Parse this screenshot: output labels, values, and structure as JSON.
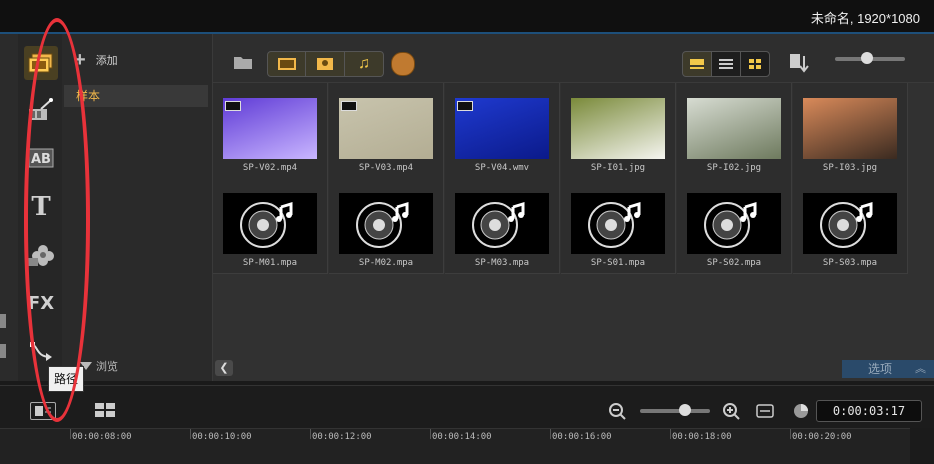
{
  "window": {
    "project_title": "未命名, 1920*1080"
  },
  "sidebar_icons": [
    {
      "name": "media",
      "icon": "media-icon"
    },
    {
      "name": "instant-project",
      "icon": "magic-wand-icon"
    },
    {
      "name": "transition",
      "icon": "transition-ab-icon"
    },
    {
      "name": "title",
      "icon": "title-t-icon"
    },
    {
      "name": "graphic",
      "icon": "graphic-flower-icon"
    },
    {
      "name": "filter",
      "icon": "fx-icon",
      "label": "FX"
    },
    {
      "name": "path",
      "icon": "path-icon"
    }
  ],
  "library": {
    "add_label": "添加",
    "selected_folder": "样本",
    "browse_label": "浏览"
  },
  "toolbar": {
    "filter_buttons": [
      "show-video",
      "show-photo",
      "show-audio"
    ],
    "view_modes": [
      "thumbnail-view",
      "list-view",
      "details-view"
    ]
  },
  "media_items": [
    {
      "name": "SP-V02.mp4",
      "type": "video",
      "colors": [
        "#5f3bd6",
        "#c9b6ff"
      ]
    },
    {
      "name": "SP-V03.mp4",
      "type": "video",
      "colors": [
        "#c8c4ad",
        "#b3ad93"
      ]
    },
    {
      "name": "SP-V04.wmv",
      "type": "video",
      "colors": [
        "#1f3ad0",
        "#0b1a8a"
      ]
    },
    {
      "name": "SP-I01.jpg",
      "type": "image",
      "colors": [
        "#7a8a3a",
        "#f5f5f0"
      ]
    },
    {
      "name": "SP-I02.jpg",
      "type": "image",
      "colors": [
        "#d7dcd2",
        "#6e7a5e"
      ]
    },
    {
      "name": "SP-I03.jpg",
      "type": "image",
      "colors": [
        "#d98a5a",
        "#3a2a20"
      ]
    },
    {
      "name": "SP-M01.mpa",
      "type": "audio"
    },
    {
      "name": "SP-M02.mpa",
      "type": "audio"
    },
    {
      "name": "SP-M03.mpa",
      "type": "audio"
    },
    {
      "name": "SP-S01.mpa",
      "type": "audio"
    },
    {
      "name": "SP-S02.mpa",
      "type": "audio"
    },
    {
      "name": "SP-S03.mpa",
      "type": "audio"
    }
  ],
  "options_label": "选项",
  "tooltip": "路径",
  "timeline": {
    "timecode": "0:00:03:17",
    "ruler_labels": [
      "00:00:08:00",
      "00:00:10:00",
      "00:00:12:00",
      "00:00:14:00",
      "00:00:16:00",
      "00:00:18:00",
      "00:00:20:00"
    ]
  },
  "colors": {
    "accent": "#f2b84a",
    "annotation": "#e8323a",
    "options_tab": "#2a4a6a"
  }
}
